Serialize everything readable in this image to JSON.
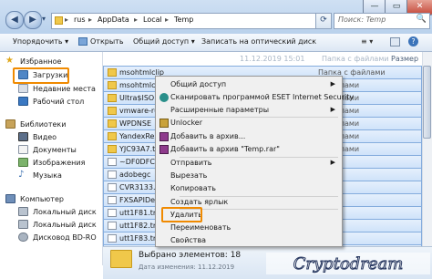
{
  "window": {
    "minimize_glyph": "—",
    "maximize_glyph": "▭",
    "close_glyph": "✕"
  },
  "address": {
    "back_glyph": "◀",
    "forward_glyph": "▶",
    "history_glyph": "▾",
    "segments": [
      "rus",
      "AppData",
      "Local",
      "Temp"
    ],
    "separator": "▸",
    "refresh_glyph": "⟳",
    "search_placeholder": "Поиск: Temp",
    "search_glyph": "🔍"
  },
  "toolbar": {
    "organize": "Упорядочить ▾",
    "open": "Открыть",
    "share": "Общий доступ ▾",
    "burn": "Записать на оптический диск",
    "view_glyph": "≡ ▾"
  },
  "sidebar": {
    "favorites": "Избранное",
    "downloads": "Загрузки",
    "recent": "Недавние места",
    "desktop": "Рабочий стол",
    "libraries": "Библиотеки",
    "video": "Видео",
    "documents": "Документы",
    "images": "Изображения",
    "music": "Музыка",
    "computer": "Компьютер",
    "local_disk_1": "Локальный диск",
    "local_disk_2": "Локальный диск",
    "dvd": "Дисковод BD-RO"
  },
  "columns": {
    "date_partial": "11.12.2019 15:01",
    "type_partial": "Папка с файлами",
    "size": "Размер"
  },
  "rows": [
    {
      "name": "msohtmlclip",
      "type": "folder",
      "info": "Папка с файлами"
    },
    {
      "name": "msohtmlclip",
      "type": "folder",
      "info": "с файлами"
    },
    {
      "name": "Ultra$ISO",
      "type": "folder",
      "info": "с файлами"
    },
    {
      "name": "vmware-rus",
      "type": "folder",
      "info": "с файлами"
    },
    {
      "name": "WPDNSE",
      "type": "folder",
      "info": "с файлами"
    },
    {
      "name": "YandexResc",
      "type": "folder",
      "info": "с файлами"
    },
    {
      "name": "YJC93A7.tm",
      "type": "folder",
      "info": "с файлами"
    },
    {
      "name": "~DF0DFC2",
      "type": "file",
      "info": "MP"
    },
    {
      "name": "adobegc",
      "type": "file",
      "info": "MP"
    },
    {
      "name": "CVR3133.tm",
      "type": "file",
      "info": "MP"
    },
    {
      "name": "FXSAPIDebu",
      "type": "file",
      "info": "MP"
    },
    {
      "name": "utt1F81.tmp",
      "type": "file",
      "info": "MP"
    },
    {
      "name": "utt1F82.tmp",
      "type": "file",
      "info": "MP"
    },
    {
      "name": "utt1F83.tmp",
      "type": "file",
      "info": "MP"
    },
    {
      "name": "utt1F84.tmp",
      "type": "file",
      "info": "MP"
    }
  ],
  "context_menu": {
    "items": [
      {
        "label": "Общий доступ",
        "submenu": true,
        "icon": "none"
      },
      {
        "label": "Сканировать программой ESET Internet Security",
        "submenu": false,
        "icon": "eset-icon"
      },
      {
        "label": "Расширенные параметры",
        "submenu": true,
        "icon": "none"
      },
      {
        "label": "Unlocker",
        "submenu": false,
        "icon": "unlocker-icon"
      },
      {
        "label": "Добавить в архив...",
        "submenu": false,
        "icon": "archive-icon"
      },
      {
        "label": "Добавить в архив \"Temp.rar\"",
        "submenu": false,
        "icon": "archive-icon"
      },
      {
        "label": "Отправить",
        "submenu": true,
        "icon": "none"
      },
      {
        "label": "Вырезать",
        "submenu": false,
        "icon": "none"
      },
      {
        "label": "Копировать",
        "submenu": false,
        "icon": "none"
      },
      {
        "label": "Создать ярлык",
        "submenu": false,
        "icon": "none"
      },
      {
        "label": "Удалить",
        "submenu": false,
        "icon": "none"
      },
      {
        "label": "Переименовать",
        "submenu": false,
        "icon": "none"
      },
      {
        "label": "Свойства",
        "submenu": false,
        "icon": "none"
      }
    ],
    "arrow_glyph": "▶"
  },
  "status": {
    "selected": "Выбрано элементов: 18",
    "date_partial": "Дата изменения: 11.12.2019"
  },
  "watermark": "Cryptodream",
  "colors": {
    "highlight": "#f08a00",
    "selection": "#cfe3fa",
    "folder": "#f0c84a"
  }
}
